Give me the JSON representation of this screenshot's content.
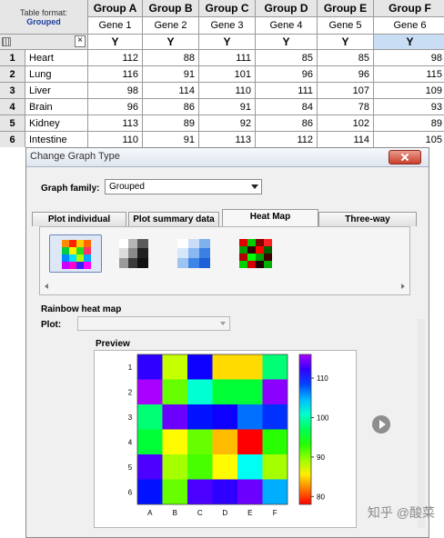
{
  "sheet": {
    "table_format_label": "Table format:",
    "table_format_value": "Grouped",
    "close_glyph": "×",
    "groups": [
      "Group A",
      "Group B",
      "Group C",
      "Group D",
      "Group E",
      "Group F"
    ],
    "genes": [
      "Gene 1",
      "Gene 2",
      "Gene 3",
      "Gene 4",
      "Gene 5",
      "Gene 6"
    ],
    "y_label": "Y",
    "rows": [
      {
        "num": "1",
        "name": "Heart",
        "values": [
          "112",
          "88",
          "111",
          "85",
          "85",
          "98"
        ]
      },
      {
        "num": "2",
        "name": "Lung",
        "values": [
          "116",
          "91",
          "101",
          "96",
          "96",
          "115"
        ]
      },
      {
        "num": "3",
        "name": "Liver",
        "values": [
          "98",
          "114",
          "110",
          "111",
          "107",
          "109"
        ]
      },
      {
        "num": "4",
        "name": "Brain",
        "values": [
          "96",
          "86",
          "91",
          "84",
          "78",
          "93"
        ]
      },
      {
        "num": "5",
        "name": "Kidney",
        "values": [
          "113",
          "89",
          "92",
          "86",
          "102",
          "89"
        ]
      },
      {
        "num": "6",
        "name": "Intestine",
        "values": [
          "110",
          "91",
          "113",
          "112",
          "114",
          "105"
        ]
      }
    ]
  },
  "dialog": {
    "title": "Change Graph Type",
    "graph_family_label": "Graph family:",
    "graph_family_value": "Grouped",
    "tabs": [
      "Plot individual values",
      "Plot summary data",
      "Heat Map",
      "Three-way"
    ],
    "active_tab": "Heat Map",
    "thumbnails": [
      "rainbow-heatmap-thumb",
      "grayscale-heatmap-thumb",
      "blue-heatmap-thumb",
      "red-green-heatmap-thumb"
    ],
    "section_title": "Rainbow heat map",
    "plot_label": "Plot:",
    "plot_value": "",
    "preview_label": "Preview"
  },
  "chart_data": {
    "type": "heatmap",
    "rows": [
      "1",
      "2",
      "3",
      "4",
      "5",
      "6"
    ],
    "columns": [
      "A",
      "B",
      "C",
      "D",
      "E",
      "F"
    ],
    "values": [
      [
        112,
        88,
        111,
        85,
        85,
        98
      ],
      [
        116,
        91,
        101,
        96,
        96,
        115
      ],
      [
        98,
        114,
        110,
        111,
        107,
        109
      ],
      [
        96,
        86,
        91,
        84,
        78,
        93
      ],
      [
        113,
        89,
        92,
        86,
        102,
        89
      ],
      [
        110,
        91,
        113,
        112,
        114,
        105
      ]
    ],
    "colorbar_ticks": [
      110,
      100,
      90,
      80
    ],
    "colorbar_range": [
      78,
      116
    ],
    "colormap": "rainbow (red low → magenta high)"
  },
  "watermark": "知乎 @酸菜"
}
